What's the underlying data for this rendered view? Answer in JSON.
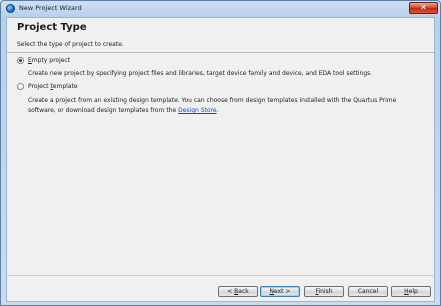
{
  "window": {
    "title": "New Project Wizard",
    "close_glyph": "✕"
  },
  "header": {
    "title": "Project Type",
    "subtitle": "Select the type of project to create."
  },
  "options": {
    "empty": {
      "accel": "E",
      "rest": "mpty project",
      "selected": true,
      "description": "Create new project by specifying project files and libraries, target device family and device, and EDA tool settings."
    },
    "template": {
      "prefix": "Project ",
      "accel": "t",
      "rest": "emplate",
      "selected": false,
      "description": "Create a project from an existing design template. You can choose from design templates installed with the Quartus Prime software, or download design templates from the ",
      "link_text": "Design Store",
      "suffix": "."
    }
  },
  "buttons": {
    "back": {
      "prefix": "< ",
      "accel": "B",
      "rest": "ack"
    },
    "next": {
      "accel": "N",
      "rest": "ext >"
    },
    "finish": {
      "accel": "F",
      "rest": "inish"
    },
    "cancel": {
      "label": "Cancel"
    },
    "help": {
      "accel": "H",
      "rest": "elp"
    }
  }
}
